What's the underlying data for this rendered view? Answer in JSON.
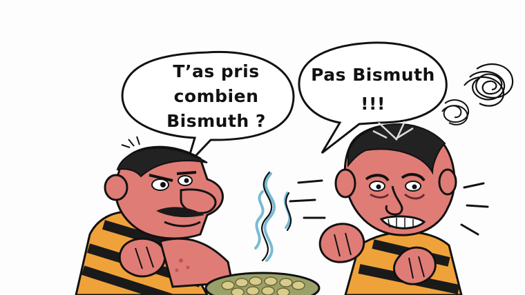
{
  "speech_bubble_left": {
    "lines": [
      "T’as pris",
      "combien",
      "Bismuth ?"
    ]
  },
  "speech_bubble_right": {
    "lines": [
      "Pas Bismuth",
      "!!!"
    ]
  },
  "colors": {
    "skin": "#e07c76",
    "skin_dark": "#c2524f",
    "stripe_orange": "#f0a23a",
    "stripe_black": "#1a1a1a",
    "hair": "#222222",
    "bowl": "#9aa06a",
    "beans": "#d8cc8a",
    "steam": "#6ab4cf"
  },
  "icons": [
    "anger-scribble-icon",
    "steam-icon",
    "shake-lines-icon"
  ]
}
